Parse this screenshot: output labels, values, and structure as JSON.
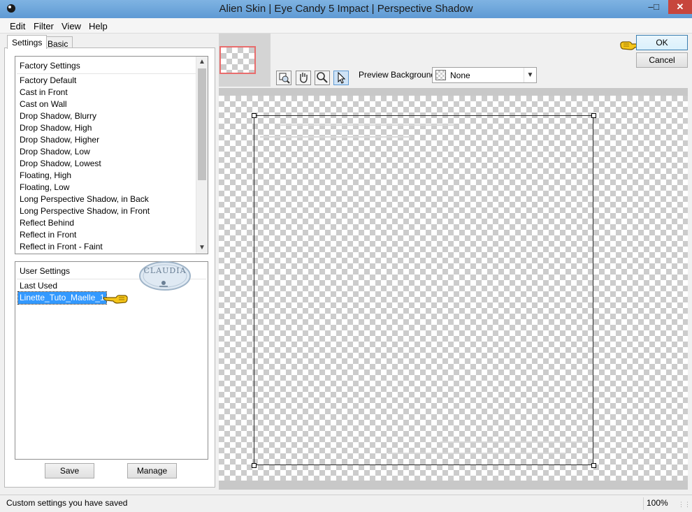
{
  "window": {
    "title": "Alien Skin | Eye Candy 5 Impact | Perspective Shadow",
    "controls": {
      "minimize": "–",
      "maximize": "□",
      "close": "✕"
    }
  },
  "menu": {
    "items": [
      {
        "label": "Edit"
      },
      {
        "label": "Filter"
      },
      {
        "label": "View"
      },
      {
        "label": "Help"
      }
    ]
  },
  "tabs": {
    "settings": "Settings",
    "basic": "Basic"
  },
  "factory_settings": {
    "header": "Factory Settings",
    "items": [
      "Factory Default",
      "Cast in Front",
      "Cast on Wall",
      "Drop Shadow, Blurry",
      "Drop Shadow, High",
      "Drop Shadow, Higher",
      "Drop Shadow, Low",
      "Drop Shadow, Lowest",
      "Floating, High",
      "Floating, Low",
      "Long Perspective Shadow, in Back",
      "Long Perspective Shadow, in Front",
      "Reflect Behind",
      "Reflect in Front",
      "Reflect in Front - Faint"
    ]
  },
  "user_settings": {
    "header": "User Settings",
    "items": [
      {
        "label": "Last Used",
        "selected": false
      },
      {
        "label": "Linette_Tuto_Maelle_1",
        "selected": true
      }
    ],
    "watermark": "CLAUDIA"
  },
  "buttons": {
    "save": "Save",
    "manage": "Manage",
    "ok": "OK",
    "cancel": "Cancel"
  },
  "preview": {
    "background_label": "Preview Background:",
    "background_value": "None",
    "tools": [
      "zoom-fit-icon",
      "hand-icon",
      "magnifier-icon",
      "arrow-pointer-icon"
    ],
    "active_tool": "arrow-pointer-icon"
  },
  "status": {
    "message": "Custom settings you have saved",
    "zoom": "100%"
  },
  "colors": {
    "titlebar": "#6fa8dc",
    "selection": "#3399ff",
    "close_button": "#c7463d",
    "thumb_border": "#e86d6d",
    "pointer_hand": "#f5c518"
  }
}
